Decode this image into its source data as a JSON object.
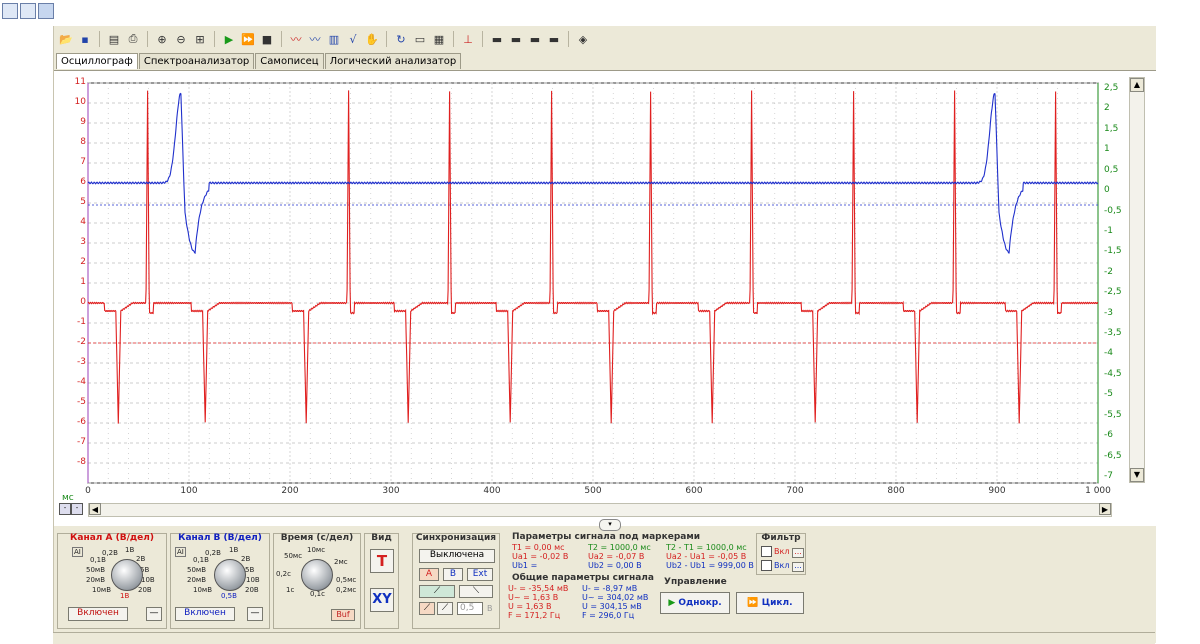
{
  "window_icons": [
    "app-icon-1",
    "app-icon-2",
    "app-icon-3"
  ],
  "tabs": [
    "Осциллограф",
    "Спектроанализатор",
    "Самописец",
    "Логический анализатор"
  ],
  "scope": {
    "y_left_ticks": [
      "11",
      "10",
      "9",
      "8",
      "7",
      "6",
      "5",
      "4",
      "3",
      "2",
      "1",
      "0",
      "-1",
      "-2",
      "-3",
      "-4",
      "-5",
      "-6",
      "-7",
      "-8"
    ],
    "y_right_ticks": [
      "2,5",
      "2",
      "1,5",
      "1",
      "0,5",
      "0",
      "-0,5",
      "-1",
      "-1,5",
      "-2",
      "-2,5",
      "-3",
      "-3,5",
      "-4",
      "-4,5",
      "-5",
      "-5,5",
      "-6",
      "-6,5",
      "-7"
    ],
    "x_unit": "мс",
    "x_ticks": [
      "0",
      "100",
      "200",
      "300",
      "400",
      "500",
      "600",
      "700",
      "800",
      "900",
      "1 000"
    ],
    "colors": {
      "channel_a": "#e02020",
      "channel_b": "#2030cc",
      "grid": "#bcbcbc"
    }
  },
  "chart_data": {
    "type": "line",
    "xlim": [
      0,
      1000
    ],
    "series": [
      {
        "name": "Канал A",
        "axis": "left",
        "ylim": [
          -9,
          11
        ],
        "baseline": 0,
        "spikes": [
          59,
          258,
          358,
          459,
          557,
          657,
          758,
          858,
          958
        ],
        "dips": [
          30,
          116,
          216,
          317,
          418,
          518,
          618,
          720,
          821,
          922
        ]
      },
      {
        "name": "Канал B",
        "axis": "right",
        "baseline_right": 0.2,
        "complexes": [
          [
            92,
            2.4,
            -1.5
          ],
          [
            898,
            2.4,
            -1.5
          ]
        ]
      }
    ]
  },
  "panels": {
    "channel_a": {
      "title": "Канал А (В/дел)",
      "scale_labels": [
        "0,2В",
        "1В",
        "0,1В",
        "2В",
        "50мВ",
        "5В",
        "20мВ",
        "10В",
        "10мВ",
        "20В"
      ],
      "value": "1В",
      "button": "Включен",
      "minus": "—",
      "auto": "AI"
    },
    "channel_b": {
      "title": "Канал В (В/дел)",
      "scale_labels": [
        "0,2В",
        "1В",
        "0,1В",
        "2В",
        "50мВ",
        "5В",
        "20мВ",
        "10В",
        "10мВ",
        "20В"
      ],
      "value": "0,5В",
      "button": "Включен",
      "minus": "—",
      "auto": "AI"
    },
    "time": {
      "title": "Время (с/дел)",
      "scale_labels": [
        "10мс",
        "50мс",
        "2мс",
        "0,5мс",
        "0,2мс",
        "0,1с",
        "1с",
        "0,2с"
      ],
      "buf": "Buf"
    },
    "view": {
      "title": "Вид",
      "t": "T",
      "xy": "XY"
    },
    "sync": {
      "title": "Синхронизация",
      "mode": "Выключена",
      "a": "A",
      "b": "B",
      "ext": "Ext",
      "level": "0,5",
      "unit": "В"
    },
    "markers": {
      "title": "Параметры сигнала под маркерами",
      "lines": [
        "T1 = 0,00 мс",
        "Ua1 = -0,02 В",
        "Ub1 = ",
        "T2 = 1000,0 мс",
        "Ua2 = -0,07 В",
        "Ub2 = 0,00 В",
        "T2 - T1 = 1000,0 мс",
        "Ua2 - Ua1 = -0,05 В",
        "Ub2 - Ub1 = 999,00 В"
      ]
    },
    "general": {
      "title": "Общие параметры сигнала",
      "lines_a": [
        "U- = -35,54 мВ",
        "U~ = 1,63 В",
        "U = 1,63 В",
        "F = 171,2 Гц"
      ],
      "lines_b": [
        "U- = -8,97 мВ",
        "U~ = 304,02 мВ",
        "U = 304,15 мВ",
        "F = 296,0 Гц"
      ]
    },
    "filter": {
      "title": "Фильтр",
      "on1": "Вкл",
      "on2": "Вкл",
      "more": "..."
    },
    "control": {
      "title": "Управление",
      "single": "Однокр.",
      "cycle": "Цикл."
    }
  }
}
